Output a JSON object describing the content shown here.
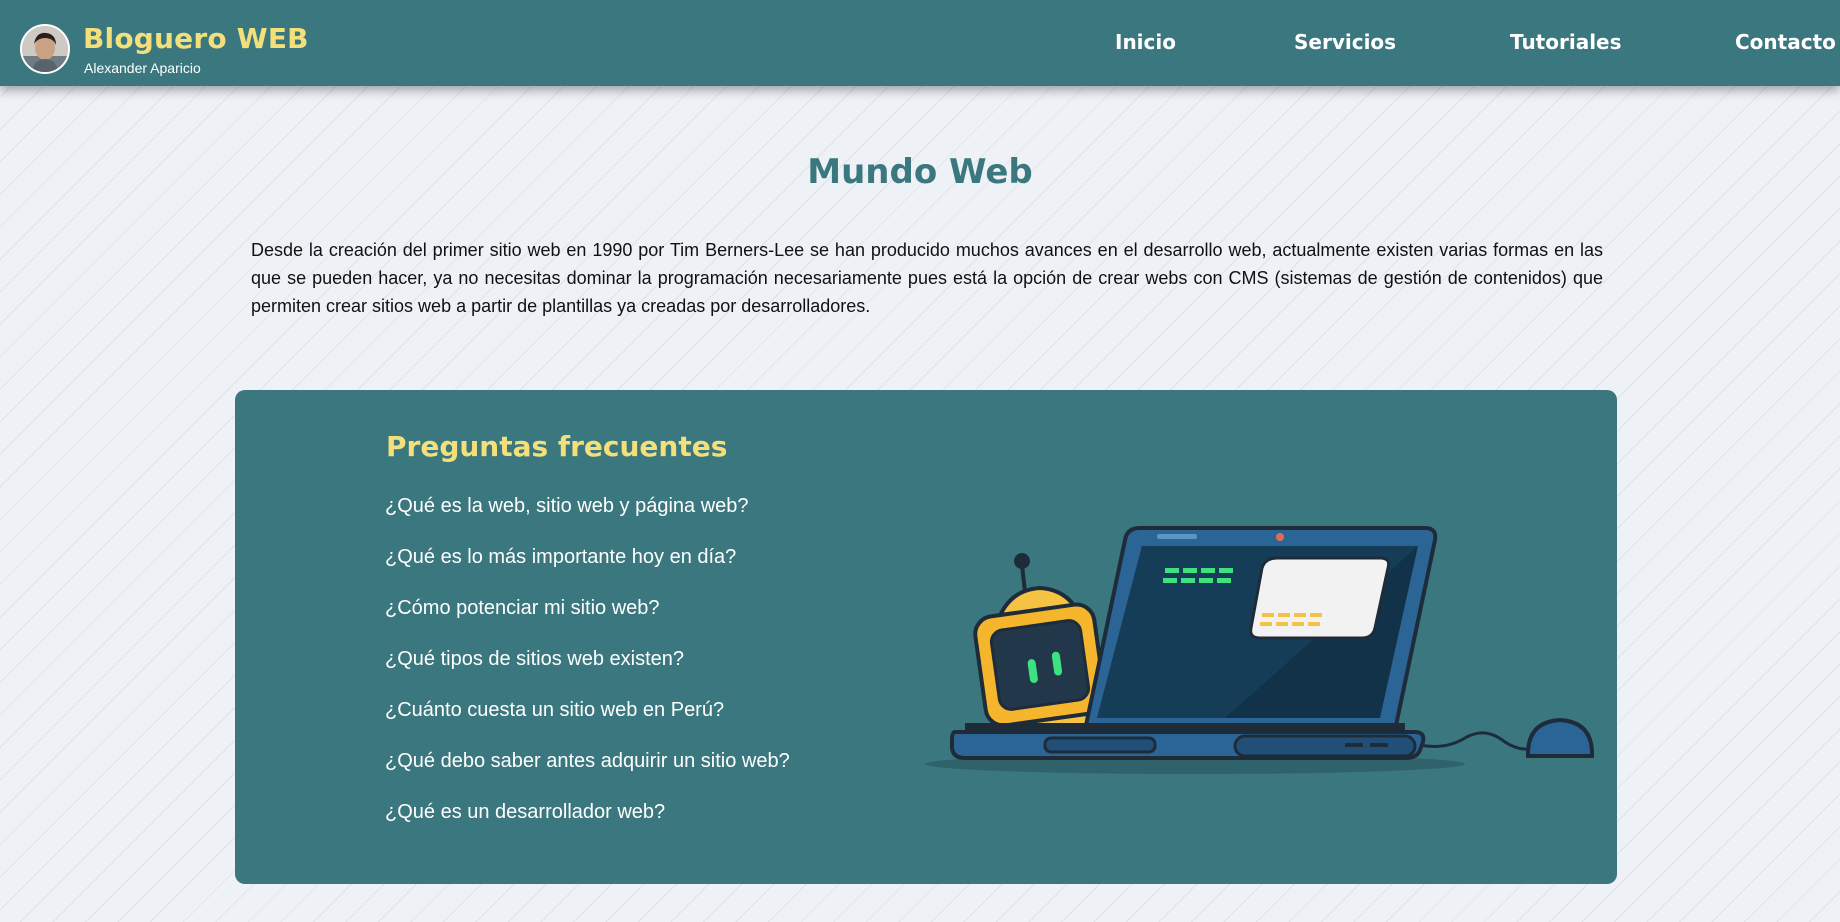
{
  "header": {
    "brand_title": "Bloguero WEB",
    "brand_subtitle": "Alexander Aparicio",
    "nav": [
      {
        "label": "Inicio"
      },
      {
        "label": "Servicios"
      },
      {
        "label": "Tutoriales"
      },
      {
        "label": "Contacto"
      }
    ]
  },
  "main": {
    "title": "Mundo Web",
    "intro": "Desde la creación del primer sitio web en 1990 por Tim Berners-Lee se han producido muchos avances en el desarrollo web, actualmente existen varias formas en las que se pueden hacer, ya no necesitas dominar la programación necesariamente pues está la opción de crear webs con CMS (sistemas de gestión de contenidos) que permiten crear sitios web a partir de plantillas ya creadas por desarrolladores."
  },
  "faq": {
    "title": "Preguntas frecuentes",
    "items": [
      {
        "label": "¿Qué es la web, sitio web y página web?"
      },
      {
        "label": "¿Qué es lo más importante hoy en día?"
      },
      {
        "label": "¿Cómo potenciar mi sitio web?"
      },
      {
        "label": "¿Qué tipos de sitios web existen?"
      },
      {
        "label": "¿Cuánto cuesta un sitio web en Perú?"
      },
      {
        "label": "¿Qué debo saber antes adquirir un sitio web?"
      },
      {
        "label": "¿Qué es un desarrollador web?"
      }
    ]
  },
  "colors": {
    "primary": "#3b777f",
    "accent": "#f4e07a",
    "background": "#eef1f6"
  },
  "icons": {
    "avatar": "avatar-photo",
    "illustration": "robot-laptop-illustration"
  }
}
